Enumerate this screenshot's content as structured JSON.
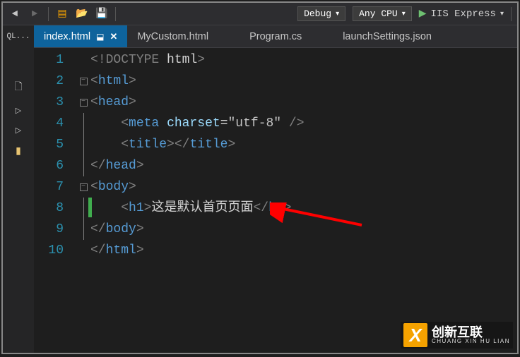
{
  "toolbar": {
    "config": "Debug",
    "platform": "Any CPU",
    "run_label": "IIS Express"
  },
  "sidebar_hint": "QL...",
  "tabs": [
    {
      "label": "index.html",
      "active": true
    },
    {
      "label": "MyCustom.html",
      "active": false
    },
    {
      "label": "Program.cs",
      "active": false
    },
    {
      "label": "launchSettings.json",
      "active": false
    }
  ],
  "line_numbers": [
    "1",
    "2",
    "3",
    "4",
    "5",
    "6",
    "7",
    "8",
    "9",
    "10"
  ],
  "code": {
    "l1_doctype": "!DOCTYPE",
    "l1_html": "html",
    "l2_tag": "html",
    "l3_tag": "head",
    "l4_tag": "meta",
    "l4_attr": "charset",
    "l4_val": "\"utf-8\"",
    "l5_tag": "title",
    "l6_tag": "head",
    "l7_tag": "body",
    "l8_tag": "h1",
    "l8_text": "这是默认首页页面",
    "l9_tag": "body",
    "l10_tag": "html"
  },
  "watermark": {
    "icon": "X",
    "big": "创新互联",
    "small": "CHUANG XIN HU LIAN"
  }
}
